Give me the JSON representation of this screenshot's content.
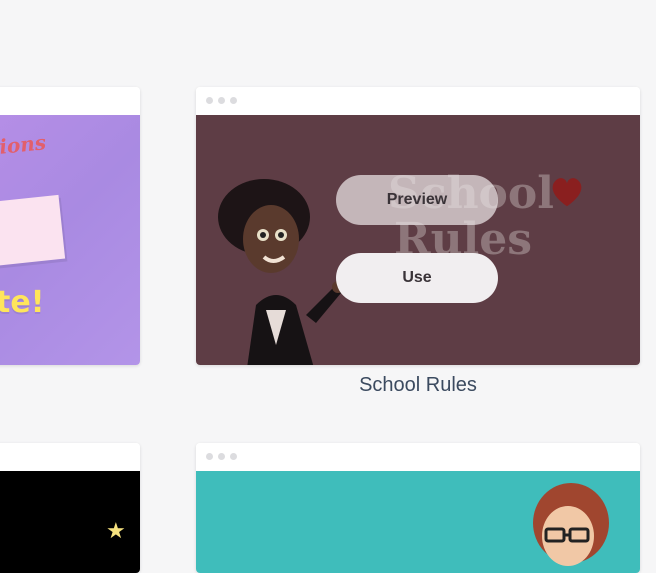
{
  "cards": [
    {
      "id": "left-top",
      "visible_text": [
        "tions",
        "te!"
      ],
      "thumb_color": "#a98ae2"
    },
    {
      "id": "school-rules",
      "title": "School Rules",
      "thumb_title_line1": "School",
      "thumb_title_line2": "Rules",
      "thumb_color": "#5e3d45",
      "actions": {
        "preview": "Preview",
        "use": "Use"
      }
    },
    {
      "id": "left-bottom",
      "thumb_color": "#000000"
    },
    {
      "id": "right-bottom",
      "thumb_color": "#3fbdbb"
    }
  ],
  "icons": [
    "window-dots-icon",
    "heart-icon",
    "star-icon"
  ]
}
